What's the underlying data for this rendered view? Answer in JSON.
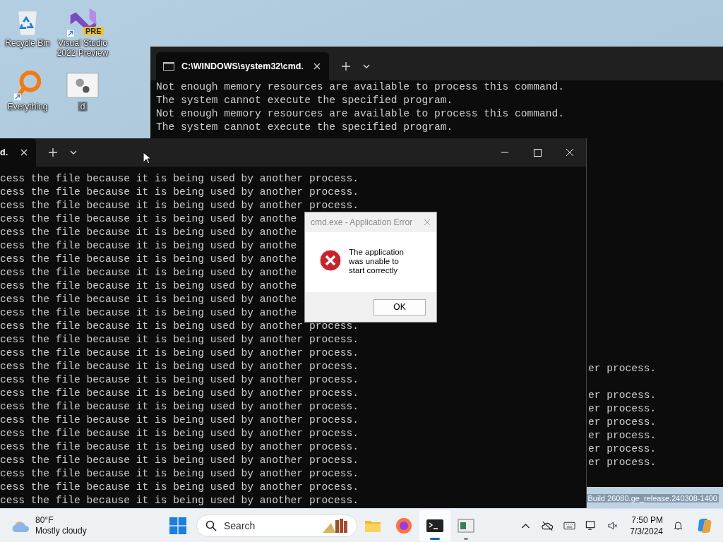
{
  "desktop_icons": [
    {
      "label": "Recycle Bin",
      "kind": "recycle"
    },
    {
      "label": "Everything",
      "kind": "everything"
    },
    {
      "label": "Visual Studio 2022 Preview",
      "kind": "vs",
      "badge": "PRE"
    },
    {
      "label": "d",
      "kind": "app"
    }
  ],
  "back_window": {
    "tab_title": "C:\\WINDOWS\\system32\\cmd.",
    "lines": [
      "Not enough memory resources are available to process this command.",
      "The system cannot execute the specified program.",
      "Not enough memory resources are available to process this command.",
      "The system cannot execute the specified program."
    ],
    "tail_blocks": [
      [
        "er process."
      ],
      [
        "er process.",
        "er process.",
        "er process.",
        "er process.",
        "er process.",
        "er process."
      ]
    ]
  },
  "front_window": {
    "tab_title": "d.",
    "lines": [
      "cess the file because it is being used by another process.",
      "cess the file because it is being used by another process.",
      "cess the file because it is being used by another process.",
      "cess the file because it is being used by anothe",
      "cess the file because it is being used by anothe",
      "cess the file because it is being used by anothe",
      "cess the file because it is being used by anothe",
      "cess the file because it is being used by anothe",
      "cess the file because it is being used by anothe",
      "cess the file because it is being used by anothe",
      "cess the file because it is being used by anothe",
      "cess the file because it is being used by another process.",
      "cess the file because it is being used by another process.",
      "cess the file because it is being used by another process.",
      "cess the file because it is being used by another process.",
      "cess the file because it is being used by another process.",
      "cess the file because it is being used by another process.",
      "cess the file because it is being used by another process.",
      "cess the file because it is being used by another process.",
      "cess the file because it is being used by another process.",
      "cess the file because it is being used by another process.",
      "cess the file because it is being used by another process.",
      "cess the file because it is being used by another process.",
      "cess the file because it is being used by another process.",
      "cess the file because it is being used by another process."
    ]
  },
  "dialog": {
    "title": "cmd.exe - Application Error",
    "message": "The application was unable to start correctly",
    "button": "OK"
  },
  "os_watermark": "Build 26080.ge_release.240308-1400",
  "taskbar": {
    "weather": {
      "temp": "80°F",
      "condition": "Mostly cloudy"
    },
    "search_placeholder": "Search",
    "apps": [
      {
        "kind": "explorer",
        "active": false,
        "running": false
      },
      {
        "kind": "firefox",
        "active": false,
        "running": false
      },
      {
        "kind": "terminal",
        "active": true,
        "running": true
      },
      {
        "kind": "app",
        "active": false,
        "running": true
      }
    ],
    "time": "7:50 PM",
    "date": "7/3/2024"
  }
}
